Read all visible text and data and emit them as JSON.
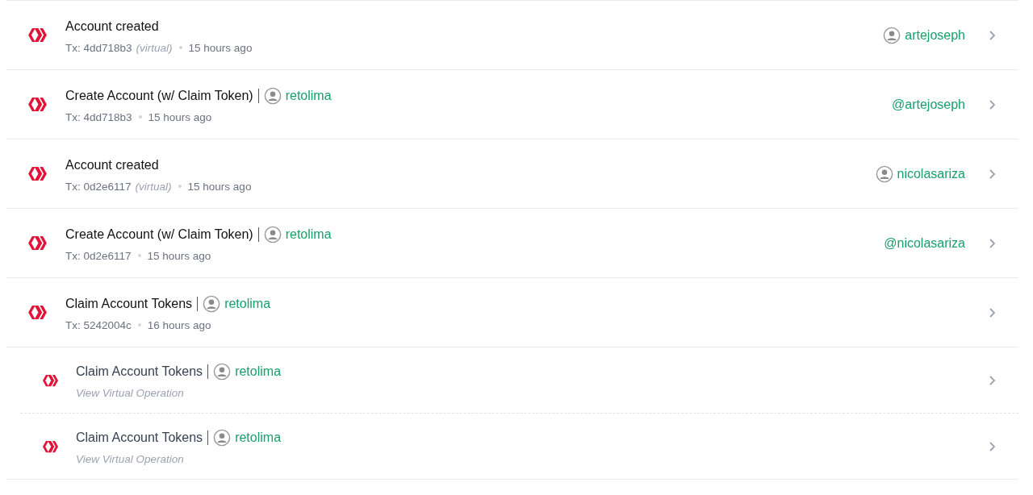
{
  "operations": [
    {
      "title": "Account created",
      "tx_label": "Tx: 4dd718b3",
      "virtual_tag": "(virtual)",
      "time": "15 hours ago",
      "target": {
        "text": "artejoseph",
        "avatar": true
      }
    },
    {
      "title": "Create Account (w/ Claim Token)",
      "actor": "retolima",
      "tx_label": "Tx: 4dd718b3",
      "time": "15 hours ago",
      "target": {
        "text": "@artejoseph",
        "avatar": false
      }
    },
    {
      "title": "Account created",
      "tx_label": "Tx: 0d2e6117",
      "virtual_tag": "(virtual)",
      "time": "15 hours ago",
      "target": {
        "text": "nicolasariza",
        "avatar": true
      }
    },
    {
      "title": "Create Account (w/ Claim Token)",
      "actor": "retolima",
      "tx_label": "Tx: 0d2e6117",
      "time": "15 hours ago",
      "target": {
        "text": "@nicolasariza",
        "avatar": false
      }
    },
    {
      "title": "Claim Account Tokens",
      "actor": "retolima",
      "tx_label": "Tx: 5242004c",
      "time": "16 hours ago",
      "children": [
        {
          "title": "Claim Account Tokens",
          "actor": "retolima",
          "link": "View Virtual Operation"
        },
        {
          "title": "Claim Account Tokens",
          "actor": "retolima",
          "link": "View Virtual Operation"
        }
      ]
    }
  ]
}
